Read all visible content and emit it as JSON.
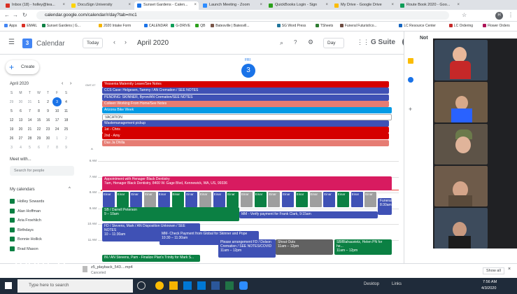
{
  "tabs": [
    {
      "label": "Inbox (18) - holley@tea...",
      "color": "#d93025"
    },
    {
      "label": "DocuSign University",
      "color": "#ffd400"
    },
    {
      "label": "Sunset Gardens - Calen...",
      "color": "#1a73e8",
      "active": true
    },
    {
      "label": "Launch Meeting - Zoom",
      "color": "#2d8cff"
    },
    {
      "label": "QuickBooks Login - Sign",
      "color": "#2ca01c"
    },
    {
      "label": "My Drive - Google Drive",
      "color": "#fbbc04"
    },
    {
      "label": "Route Book 2020 - Goo...",
      "color": "#0f9d58"
    }
  ],
  "url": "calendar.google.com/calendar/r/day?tab=mc1",
  "bookmarks": [
    "Apps",
    "EMAIL",
    "Sunset Gardens | G...",
    "2020 Intake Form",
    "CALENDAR",
    "G-DRIVE",
    "QB",
    "Batesville | Batesvill...",
    "SG Word Press",
    "TSheets",
    "Funeral Futurist/co...",
    "LC Resource Center",
    "LC Ordering",
    "Flower Orders"
  ],
  "header": {
    "title": "Calendar",
    "today": "Today",
    "month": "April 2020",
    "view": "Day",
    "brand": "G Suite",
    "avatar": "H"
  },
  "sidebar": {
    "create": "Create",
    "month": "April 2020",
    "days_header": [
      "S",
      "M",
      "T",
      "W",
      "T",
      "F",
      "S"
    ],
    "weeks": [
      [
        "29",
        "30",
        "31",
        "1",
        "2",
        "3",
        "4"
      ],
      [
        "5",
        "6",
        "7",
        "8",
        "9",
        "10",
        "11"
      ],
      [
        "12",
        "13",
        "14",
        "15",
        "16",
        "17",
        "18"
      ],
      [
        "19",
        "20",
        "21",
        "22",
        "23",
        "24",
        "25"
      ],
      [
        "26",
        "27",
        "28",
        "29",
        "30",
        "1",
        "2"
      ],
      [
        "3",
        "4",
        "5",
        "6",
        "7",
        "8",
        "9"
      ]
    ],
    "meet": "Meet with...",
    "search_people": "Search for people",
    "my_calendars": "My calendars",
    "calendars": [
      {
        "name": "Holley Sowards",
        "color": "#0b8043"
      },
      {
        "name": "Alan Hoffman",
        "color": "#0b8043"
      },
      {
        "name": "Aria Froehlich",
        "color": "#0b8043"
      },
      {
        "name": "Birthdays",
        "color": "#0b8043"
      },
      {
        "name": "Bonnie Hollick",
        "color": "#0b8043"
      },
      {
        "name": "Brad Mason",
        "color": "#0b8043"
      }
    ]
  },
  "day": {
    "dow": "FRI",
    "num": "3",
    "tz": "GMT-07"
  },
  "allday": [
    {
      "label": "Yessenia Maternity Leave/See Notes",
      "color": "#d50000"
    },
    {
      "label": "CCS Case: Helgesen, Tammy / AN Cremation / SEE NOTES",
      "color": "#3f51b5"
    },
    {
      "label": "PENDING: SKINNER, Byron/AN Cremation/SEE NOTES",
      "color": "#3f51b5"
    },
    {
      "label": "Colleen Working From Home/See Notes",
      "color": "#e67c73"
    },
    {
      "label": "Arizona Bike Week",
      "color": "#039be5"
    },
    {
      "label": "VACATION",
      "color": "#ffffff"
    },
    {
      "label": "Wastemanagement pickup",
      "color": "#3f51b5"
    },
    {
      "label": "1st - Chris",
      "color": "#d50000"
    },
    {
      "label": "2nd - Amy",
      "color": "#d50000"
    },
    {
      "label": "Das Ja Dhilla",
      "color": "#e67c73"
    }
  ],
  "times": [
    "6 AM",
    "7 AM",
    "8 AM",
    "9 AM",
    "10 AM",
    "11 AM"
  ],
  "events": {
    "appt_title": "Appointment with Henager Black Dentistry",
    "appt_sub": "7am, Henager Black Dentistry, 8400 W. Gage Blvd, Kennewick, WA, US, 99336",
    "einar": [
      "Einar",
      "Einar",
      "Einar",
      "Einar",
      "Einar",
      "Einar",
      "Einar",
      "Einar",
      "Einar",
      "Einar",
      "Einar",
      "Einar",
      "Einar",
      "Einar",
      "Einar",
      "Einar",
      "Einar",
      "Einar",
      "Einar",
      "Einar"
    ],
    "sb": "SB / Darrell Peterson",
    "sb_time": "9 – 10am",
    "mm": "MM - Verify payment for Frank Clark, 9:15am",
    "funeral": "Funeral, 8:30am",
    "fd": "FD / Stevens, Mark / AN Disposition Unknown / SEE NOTES",
    "fd_time": "10 – 11:30am",
    "mm2": "MM- Check Payment from Global for Skinner and Pope",
    "mm2_time": "10:30 – 11:30am",
    "please": "Please arrangement FD / Dolson Cremation / SEE NOTES/COVID",
    "please_time": "11am – 12pm",
    "shout": "Shout Outs",
    "shout_time": "11am – 12pm",
    "sb2": "SB/Blahauvietz, Helen PN for he...",
    "sb2_time": "11am – 12pm",
    "in": "IN / AN Stevens, Pam - Finalize Plan's Trinity for Mark S..."
  },
  "download": {
    "file": "z5_playback_543....mp4",
    "sub": "Canceled",
    "show_all": "Show all"
  },
  "taskbar": {
    "search": "Type here to search",
    "desktop": "Desktop",
    "links": "Links",
    "time": "7:56 AM",
    "date": "4/3/2020"
  },
  "zoom": "zoom_0",
  "notes_label": "Not"
}
